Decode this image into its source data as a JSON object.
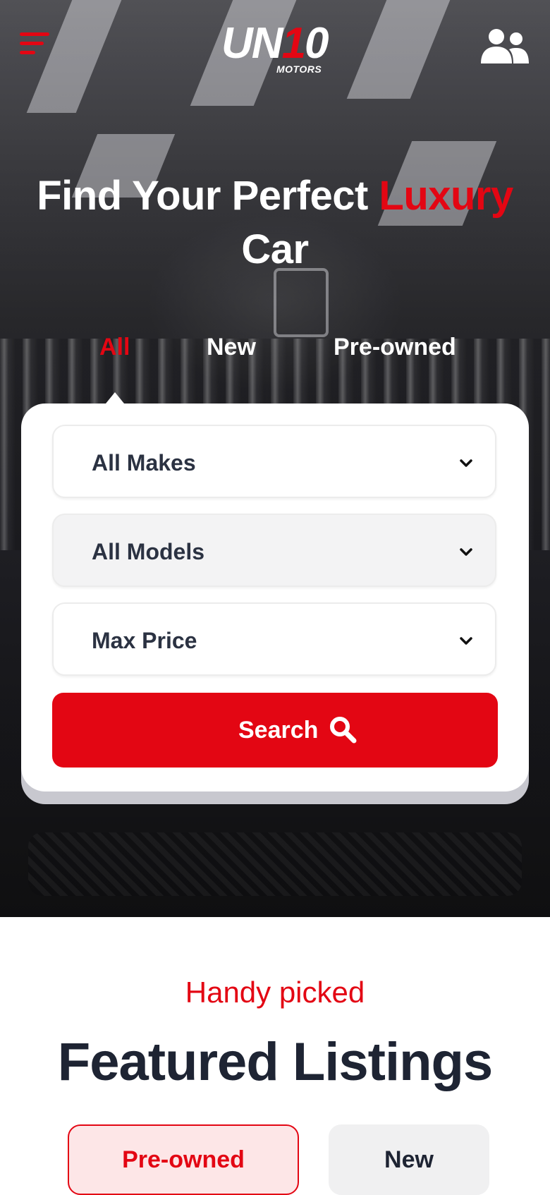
{
  "header": {
    "logo_text_a": "UN",
    "logo_text_b": "1",
    "logo_text_c": "0",
    "logo_subtext": "MOTORS",
    "menu_icon": "hamburger-menu-icon",
    "account_icon": "users-icon"
  },
  "hero": {
    "title_part1": "Find Your Perfect ",
    "title_accent": "Luxury",
    "title_part2": " Car",
    "tabs": [
      {
        "label": "All",
        "active": true
      },
      {
        "label": "New",
        "active": false
      },
      {
        "label": "Pre-owned",
        "active": false
      }
    ]
  },
  "search_form": {
    "make_select": "All Makes",
    "model_select": "All Models",
    "price_select": "Max Price",
    "search_label": "Search",
    "search_icon": "magnifier-icon"
  },
  "featured": {
    "kicker": "Handy picked",
    "title": "Featured Listings",
    "filters": [
      {
        "label": "Pre-owned",
        "active": true
      },
      {
        "label": "New",
        "active": false
      }
    ]
  },
  "colors": {
    "accent": "#e30613",
    "dark_text": "#1e2433",
    "white": "#ffffff"
  }
}
